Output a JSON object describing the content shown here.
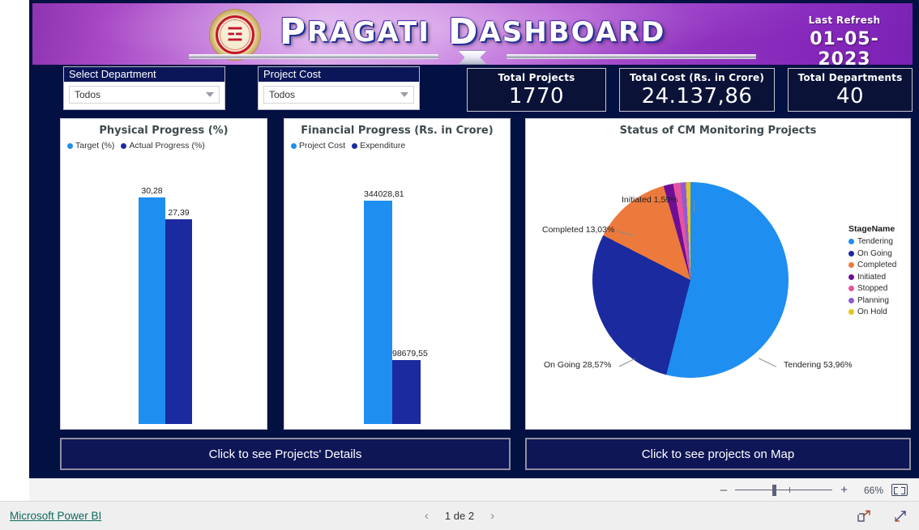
{
  "header": {
    "title_main": "Pragati",
    "title_second": "Dashboard",
    "emblem_name": "maharashtra-government-emblem",
    "refresh_label": "Last Refresh",
    "refresh_date": "01-05-2023"
  },
  "slicers": [
    {
      "name": "select-department",
      "label": "Select Department",
      "value": "Todos"
    },
    {
      "name": "project-cost",
      "label": "Project Cost",
      "value": "Todos"
    }
  ],
  "kpis": [
    {
      "name": "total-projects",
      "title": "Total Projects",
      "value": "1770"
    },
    {
      "name": "total-cost",
      "title": "Total Cost (Rs. in Crore)",
      "value": "24.137,86"
    },
    {
      "name": "total-departments",
      "title": "Total Departments",
      "value": "40"
    }
  ],
  "chart_data": [
    {
      "type": "bar",
      "title": "Physical Progress (%)",
      "categories": [
        "Target (%)",
        "Actual Progress (%)"
      ],
      "values": [
        30.28,
        27.39
      ],
      "value_labels": [
        "30,28",
        "27,39"
      ],
      "colors": [
        "#1f8ef1",
        "#1b2a9e"
      ],
      "legend": [
        "Target (%)",
        "Actual Progress (%)"
      ],
      "legend_position": "top-left",
      "xlabel": "",
      "ylabel": "",
      "ylim": [
        0,
        33
      ],
      "grid": false
    },
    {
      "type": "bar",
      "title": "Financial Progress (Rs. in Crore)",
      "categories": [
        "Project Cost",
        "Expenditure"
      ],
      "values": [
        344028.81,
        98679.55
      ],
      "value_labels": [
        "344028,81",
        "98679,55"
      ],
      "colors": [
        "#1f8ef1",
        "#1b2a9e"
      ],
      "legend": [
        "Project Cost",
        "Expenditure"
      ],
      "legend_position": "top-left",
      "xlabel": "",
      "ylabel": "",
      "ylim": [
        0,
        380000
      ],
      "grid": false
    },
    {
      "type": "pie",
      "title": "Status of CM Monitoring Projects",
      "legend_title": "StageName",
      "legend_position": "right",
      "categories": [
        "Tendering",
        "On Going",
        "Completed",
        "Initiated",
        "Stopped",
        "Planning",
        "On Hold"
      ],
      "values": [
        53.96,
        28.57,
        13.03,
        1.59,
        1.2,
        0.9,
        0.75
      ],
      "colors": [
        "#1f8ef1",
        "#1b2a9e",
        "#ec7a3c",
        "#6d0f96",
        "#e8529f",
        "#8e5bd6",
        "#e8c419"
      ],
      "callout_labels": [
        "Tendering 53,96%",
        "On Going 28,57%",
        "Completed 13,03%",
        "Initiated 1,59%"
      ]
    }
  ],
  "buttons": [
    {
      "name": "projects-details-button",
      "label": "Click to see Projects' Details"
    },
    {
      "name": "projects-map-button",
      "label": "Click to see projects on Map"
    }
  ],
  "zoombar": {
    "minus": "–",
    "plus": "+",
    "percent": "66%",
    "fit_icon": "fit-to-page-icon"
  },
  "footer": {
    "brand": "Microsoft Power BI",
    "prev_icon": "‹",
    "next_icon": "›",
    "page_indicator": "1 de 2",
    "share_icon": "share-icon",
    "fullscreen_icon": "fullscreen-icon"
  }
}
